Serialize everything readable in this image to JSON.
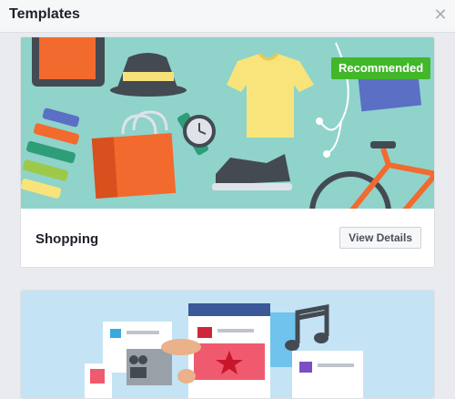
{
  "header": {
    "title": "Templates",
    "close_icon": "close-icon"
  },
  "templates": [
    {
      "name": "Shopping",
      "badge": "Recommended",
      "action_label": "View Details",
      "banner_color": "#8fd3cb"
    },
    {
      "name": "",
      "banner_color": "#c4e4f5"
    }
  ],
  "colors": {
    "accent_green": "#42b72a",
    "page_bg": "#e9ebee"
  }
}
